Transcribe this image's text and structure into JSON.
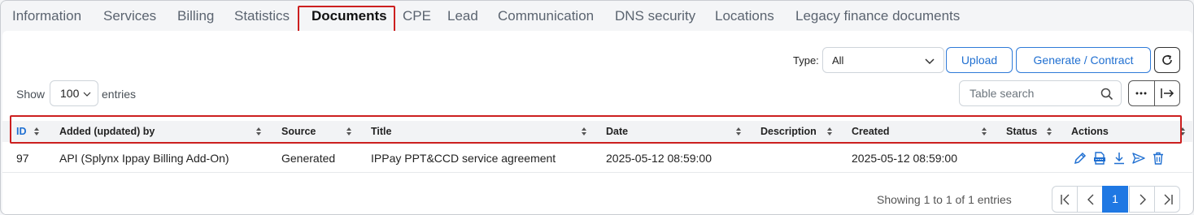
{
  "tabs": [
    {
      "label": "Information"
    },
    {
      "label": "Services"
    },
    {
      "label": "Billing"
    },
    {
      "label": "Statistics"
    },
    {
      "label": "Documents",
      "active": true
    },
    {
      "label": "CPE"
    },
    {
      "label": "Lead"
    },
    {
      "label": "Communication"
    },
    {
      "label": "DNS security"
    },
    {
      "label": "Locations"
    },
    {
      "label": "Legacy finance documents"
    }
  ],
  "toolbar": {
    "type_label": "Type:",
    "type_value": "All",
    "upload_label": "Upload",
    "generate_label": "Generate / Contract"
  },
  "length_menu": {
    "show_label": "Show",
    "value": "100",
    "entries_label": "entries"
  },
  "search": {
    "placeholder": "Table search"
  },
  "table": {
    "columns": [
      "ID",
      "Added (updated) by",
      "Source",
      "Title",
      "Date",
      "Description",
      "Created",
      "Status",
      "Actions"
    ],
    "rows": [
      {
        "id": "97",
        "added_by": "API (Splynx Ippay Billing Add-On)",
        "source": "Generated",
        "title": "IPPay PPT&CCD service agreement",
        "date": "2025-05-12 08:59:00",
        "description": "",
        "created": "2025-05-12 08:59:00",
        "status": ""
      }
    ]
  },
  "footer": {
    "info": "Showing 1 to 1 of 1 entries",
    "current_page": "1"
  },
  "colors": {
    "accent": "#1f6fd1",
    "highlight": "#cc1f1f",
    "active_page": "#1f78e3"
  },
  "icons": [
    "chevron-down-icon",
    "refresh-icon",
    "search-icon",
    "more-icon",
    "expand-icon",
    "sort-icon",
    "edit-icon",
    "pdf-icon",
    "download-icon",
    "send-icon",
    "trash-icon",
    "first-page-icon",
    "prev-page-icon",
    "next-page-icon",
    "last-page-icon"
  ]
}
